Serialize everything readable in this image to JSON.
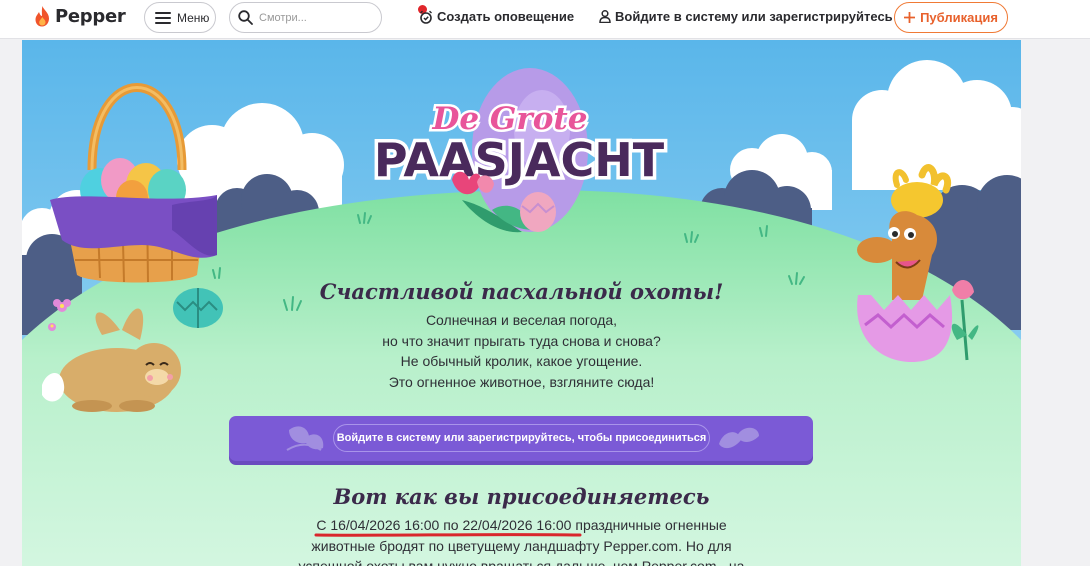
{
  "header": {
    "logo_text": "Pepper",
    "menu_label": "Меню",
    "search_placeholder": "Смотри...",
    "alert_label": "Создать оповещение",
    "login_label": "Войдите в систему или зарегистрируйтесь",
    "publish_label": "Публикация"
  },
  "banner": {
    "title_line1": "De Grote",
    "title_line2": "PAASJACHT",
    "heading": "Счастливой пасхальной охоты!",
    "paragraph_lines": [
      "Солнечная и веселая погода,",
      "но что значит прыгать туда снова и снова?",
      "Не обычный кролик, какое угощение.",
      "Это огненное животное, взгляните сюда!"
    ],
    "cta_label": "Войдите в систему или зарегистрируйтесь, чтобы присоединиться",
    "how_heading": "Вот как вы присоединяетесь",
    "how_date_range": "С 16/04/2026 16:00 по 22/04/2026 16:00",
    "how_line1_rest": " праздничные огненные",
    "how_line2": "животные бродят по цветущему ландшафту Pepper.com. Но для",
    "how_line3": "успешной охоты вам нужно вращаться дальше, чем Pepper.com - на"
  },
  "colors": {
    "brand": "#e8612c",
    "cta_purple": "#7b5ad6",
    "sky": "#6fc2ec",
    "grass": "#c6f0d0",
    "title_purple": "#4a2a5c",
    "underline_red": "#d9262c"
  },
  "icons": {
    "logo": "flame-icon",
    "menu": "hamburger-icon",
    "search": "search-icon",
    "alert": "alarm-clock-icon",
    "login": "user-icon",
    "publish": "plus-icon"
  }
}
